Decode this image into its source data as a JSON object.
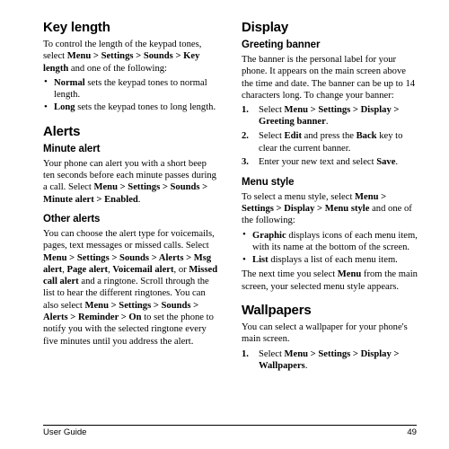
{
  "document": {
    "type": "user-guide-page",
    "footer": {
      "left_label": "User Guide",
      "page_number": "49"
    }
  },
  "left_column": {
    "key_length": {
      "heading": "Key length",
      "intro_plain_1": "To control the length of the keypad tones, select ",
      "intro_bold_1": "Menu > Settings > Sounds > Key length",
      "intro_plain_2": " and one of the following:",
      "bullets": [
        {
          "bullet": "•",
          "bold": "Normal",
          "plain": " sets the keypad tones to normal length."
        },
        {
          "bullet": "•",
          "bold": "Long",
          "plain": " sets the keypad tones to long length."
        }
      ]
    },
    "alerts": {
      "heading": "Alerts",
      "minute_alert": {
        "heading": "Minute alert",
        "plain_1": "Your phone can alert you with a short beep ten seconds before each minute passes during a call. Select ",
        "bold_1": "Menu > Settings > Sounds > Minute alert > Enabled",
        "plain_2": "."
      },
      "other_alerts": {
        "heading": "Other alerts",
        "plain_1": "You can choose the alert type for voicemails, pages, text messages or missed calls. Select ",
        "bold_1": "Menu > Settings > Sounds > Alerts > Msg alert",
        "plain_2": ", ",
        "bold_2": "Page alert",
        "plain_3": ", ",
        "bold_3": "Voicemail alert",
        "plain_4": ", or ",
        "bold_4": "Missed call alert",
        "plain_5": " and a ringtone. Scroll through the list to hear the different ringtones. You can also select ",
        "bold_5": "Menu > Settings > Sounds > Alerts > Reminder > On",
        "plain_6": " to set the phone to notify you with the selected ringtone every five minutes until you address the alert."
      }
    }
  },
  "right_column": {
    "display": {
      "heading": "Display",
      "greeting_banner": {
        "heading": "Greeting banner",
        "plain_1": "The banner is the personal label for your phone. It appears on the main screen above the time and date. The banner can be up to 14 characters long. To change your banner:",
        "steps": [
          {
            "number": "1.",
            "plain_1": "Select ",
            "bold_1": "Menu > Settings > Display > Greeting banner",
            "plain_2": "."
          },
          {
            "number": "2.",
            "plain_1": "Select ",
            "bold_1": "Edit",
            "plain_2": " and press the ",
            "bold_2": "Back",
            "plain_3": " key to clear the current banner."
          },
          {
            "number": "3.",
            "plain_1": "Enter your new text and select ",
            "bold_1": "Save",
            "plain_2": "."
          }
        ]
      },
      "menu_style": {
        "heading": "Menu style",
        "plain_1": "To select a menu style, select ",
        "bold_1": "Menu > Settings > Display > Menu style",
        "plain_2": " and one of the following:",
        "bullets": [
          {
            "bullet": "•",
            "bold": "Graphic",
            "plain": " displays icons of each menu item, with its name at the bottom of the screen."
          },
          {
            "bullet": "•",
            "bold": "List",
            "plain": " displays a list of each menu item."
          }
        ],
        "closing_plain_1": "The next time you select ",
        "closing_bold_1": "Menu",
        "closing_plain_2": " from the main screen, your selected menu style appears."
      },
      "wallpapers": {
        "heading": "Wallpapers",
        "plain_1": "You can select a wallpaper for your phone's main screen.",
        "steps": [
          {
            "number": "1.",
            "plain_1": "Select ",
            "bold_1": "Menu > Settings > Display > Wallpapers",
            "plain_2": "."
          }
        ]
      }
    }
  }
}
